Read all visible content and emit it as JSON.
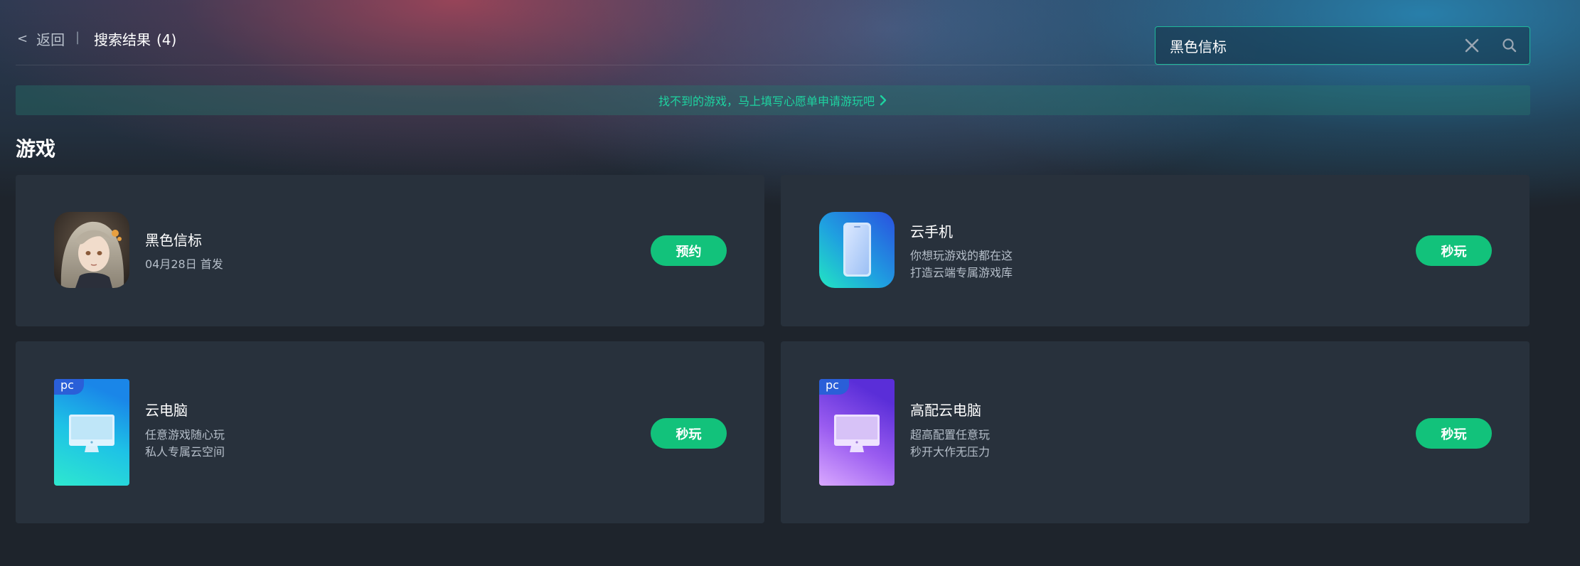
{
  "header": {
    "back_chevron": "<",
    "back_label": "返回",
    "divider": "|",
    "title": "搜索结果",
    "count": "(4)"
  },
  "search": {
    "value": "黑色信标",
    "placeholder": ""
  },
  "wish_banner": {
    "text": "找不到的游戏，马上填写心愿单申请游玩吧"
  },
  "section": {
    "title": "游戏"
  },
  "cards": [
    {
      "name": "黑色信标",
      "desc1": "04月28日 首发",
      "desc2": "",
      "action": "预约",
      "icon": "game-avatar"
    },
    {
      "name": "云手机",
      "desc1": "你想玩游戏的都在这",
      "desc2": "打造云端专属游戏库",
      "action": "秒玩",
      "icon": "phone-icon"
    },
    {
      "name": "云电脑",
      "desc1": "任意游戏随心玩",
      "desc2": "私人专属云空间",
      "action": "秒玩",
      "icon": "monitor-icon",
      "tag": "pc"
    },
    {
      "name": "高配云电脑",
      "desc1": "超高配置任意玩",
      "desc2": "秒开大作无压力",
      "action": "秒玩",
      "icon": "monitor-icon",
      "tag": "pc"
    }
  ],
  "colors": {
    "accent": "#12c27b",
    "card_bg": "#28313c",
    "page_bg": "#1e242c",
    "search_border": "#1fb89a",
    "banner_text": "#1ed3a0"
  }
}
